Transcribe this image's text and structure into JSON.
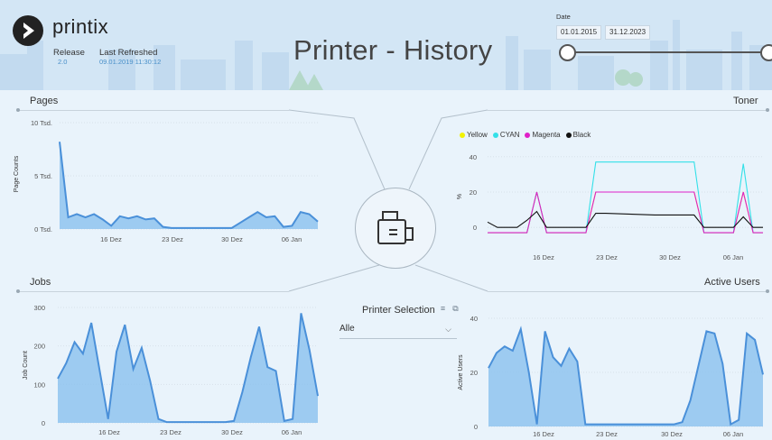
{
  "header": {
    "brand": "printix",
    "release_label": "Release",
    "release_value": "2.0",
    "refreshed_label": "Last Refreshed",
    "refreshed_value": "09.01.2019 11:30:12",
    "title": "Printer - History",
    "date_label": "Date",
    "date_start": "01.01.2015",
    "date_end": "31.12.2023"
  },
  "sections": {
    "pages": "Pages",
    "toner": "Toner",
    "jobs": "Jobs",
    "active_users": "Active Users"
  },
  "printer_selection": {
    "title": "Printer Selection",
    "value": "Alle"
  },
  "colors": {
    "area_fill": "#8fc3ee",
    "area_line": "#4a90d9",
    "yellow": "#f2f200",
    "cyan": "#33e0e8",
    "magenta": "#e020c8",
    "black": "#111111"
  },
  "icons": {
    "logo": "printix-logo-icon",
    "center": "printer-icon",
    "filter": "filter-icon",
    "focus": "focus-mode-icon",
    "dropdown": "chevron-down-icon"
  },
  "chart_data": [
    {
      "type": "area",
      "id": "pages",
      "ylabel": "Page Counts",
      "yticks": [
        "0 Tsd.",
        "5 Tsd.",
        "10 Tsd."
      ],
      "ylim": [
        0,
        10000
      ],
      "xticks": [
        "16 Dez",
        "23 Dez",
        "30 Dez",
        "06 Jan"
      ],
      "values": [
        8200,
        1100,
        1400,
        1100,
        1400,
        900,
        300,
        1200,
        1000,
        1200,
        900,
        1000,
        200,
        100,
        100,
        100,
        100,
        100,
        100,
        100,
        100,
        600,
        1100,
        1600,
        1100,
        1200,
        200,
        300,
        1600,
        1400,
        700
      ]
    },
    {
      "type": "line",
      "id": "toner",
      "ylabel": "%",
      "yticks": [
        "0",
        "20",
        "40"
      ],
      "ylim": [
        -5,
        45
      ],
      "xticks": [
        "16 Dez",
        "23 Dez",
        "30 Dez",
        "06 Jan"
      ],
      "legend": [
        "Yellow",
        "CYAN",
        "Magenta",
        "Black"
      ],
      "series": [
        {
          "name": "Yellow",
          "values": [
            -3,
            -3,
            -3,
            -3,
            -3,
            20,
            -3,
            -3,
            -3,
            -3,
            -3,
            20,
            20,
            20,
            20,
            20,
            20,
            20,
            20,
            20,
            20,
            20,
            -3,
            -3,
            -3,
            -3,
            20,
            -3,
            -3
          ]
        },
        {
          "name": "CYAN",
          "values": [
            -3,
            -3,
            -3,
            -3,
            -3,
            20,
            -3,
            -3,
            -3,
            -3,
            -3,
            37,
            37,
            37,
            37,
            37,
            37,
            37,
            37,
            37,
            37,
            37,
            -3,
            -3,
            -3,
            -3,
            36,
            -3,
            -3
          ]
        },
        {
          "name": "Magenta",
          "values": [
            -3,
            -3,
            -3,
            -3,
            -3,
            20,
            -3,
            -3,
            -3,
            -3,
            -3,
            20,
            20,
            20,
            20,
            20,
            20,
            20,
            20,
            20,
            20,
            20,
            -3,
            -3,
            -3,
            -3,
            20,
            -3,
            -3
          ]
        },
        {
          "name": "Black",
          "values": [
            3,
            0,
            0,
            0,
            4,
            9,
            0,
            0,
            0,
            0,
            0,
            8,
            8,
            7.8,
            7.6,
            7.4,
            7.2,
            7,
            7,
            7,
            7,
            7,
            0,
            0,
            0,
            0,
            6,
            0,
            0
          ]
        }
      ]
    },
    {
      "type": "area",
      "id": "jobs",
      "ylabel": "Job Count",
      "yticks": [
        "0",
        "100",
        "200",
        "300"
      ],
      "ylim": [
        0,
        300
      ],
      "xticks": [
        "16 Dez",
        "23 Dez",
        "30 Dez",
        "06 Jan"
      ],
      "values": [
        115,
        155,
        210,
        180,
        260,
        135,
        10,
        185,
        255,
        140,
        195,
        110,
        10,
        2,
        2,
        2,
        2,
        2,
        2,
        2,
        2,
        5,
        80,
        170,
        250,
        145,
        135,
        5,
        10,
        285,
        190,
        70
      ]
    },
    {
      "type": "area",
      "id": "active_users",
      "ylabel": "Active Users",
      "yticks": [
        "0",
        "20",
        "40"
      ],
      "ylim": [
        0,
        50
      ],
      "xticks": [
        "16 Dez",
        "23 Dez",
        "30 Dez",
        "06 Jan"
      ],
      "values": [
        27,
        34,
        37,
        35,
        45,
        25,
        1,
        44,
        32,
        28,
        36,
        30,
        1,
        1,
        1,
        1,
        1,
        1,
        1,
        1,
        1,
        1,
        1,
        1,
        2,
        12,
        28,
        44,
        43,
        29,
        1,
        3,
        43,
        40,
        24
      ]
    }
  ]
}
